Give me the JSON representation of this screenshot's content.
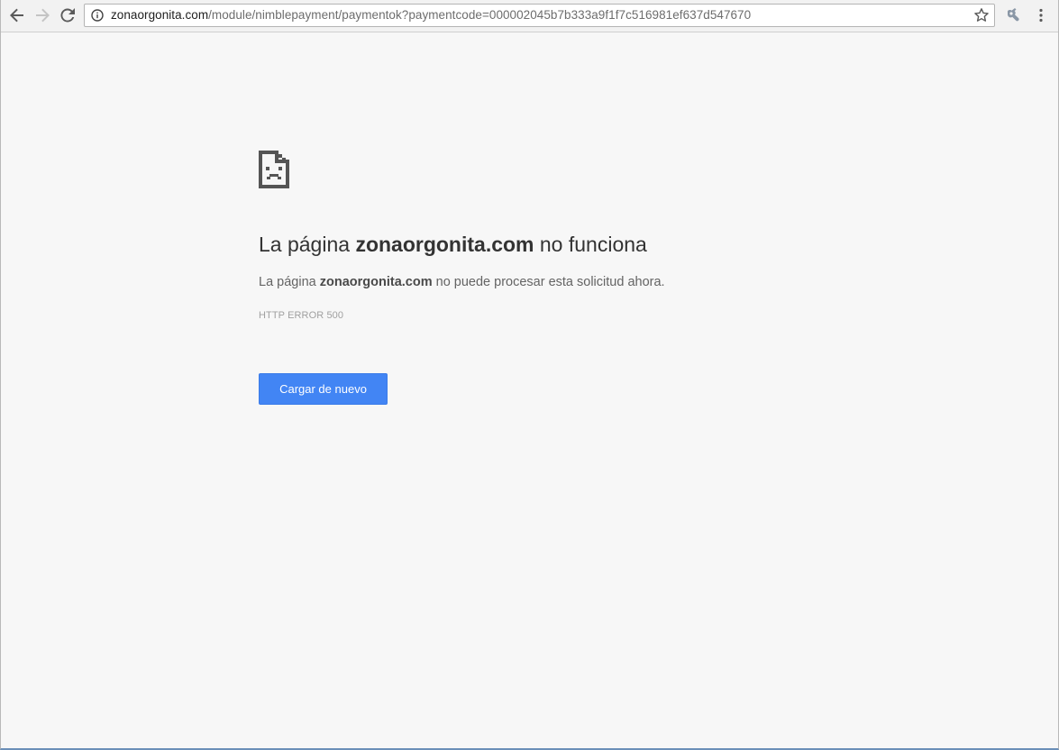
{
  "browser": {
    "url_host": "zonaorgonita.com",
    "url_path": "/module/nimblepayment/paymentok?paymentcode=000002045b7b333a9f1f7c516981ef637d547670",
    "icons": {
      "back": "back-arrow-icon",
      "forward": "forward-arrow-icon",
      "reload": "reload-icon",
      "info": "info-icon",
      "bookmark": "star-icon",
      "extension": "extension-icon",
      "menu": "kebab-menu-icon"
    }
  },
  "error_page": {
    "title_prefix": "La página",
    "title_host": "zonaorgonita.com",
    "title_suffix": "no funciona",
    "detail_prefix": "La página",
    "detail_host": "zonaorgonita.com",
    "detail_suffix": "no puede procesar esta solicitud ahora.",
    "error_code": "HTTP ERROR 500",
    "reload_label": "Cargar de nuevo",
    "icon": "sad-page-icon"
  },
  "colors": {
    "button_blue": "#4285f4",
    "page_background": "#f7f7f7"
  }
}
